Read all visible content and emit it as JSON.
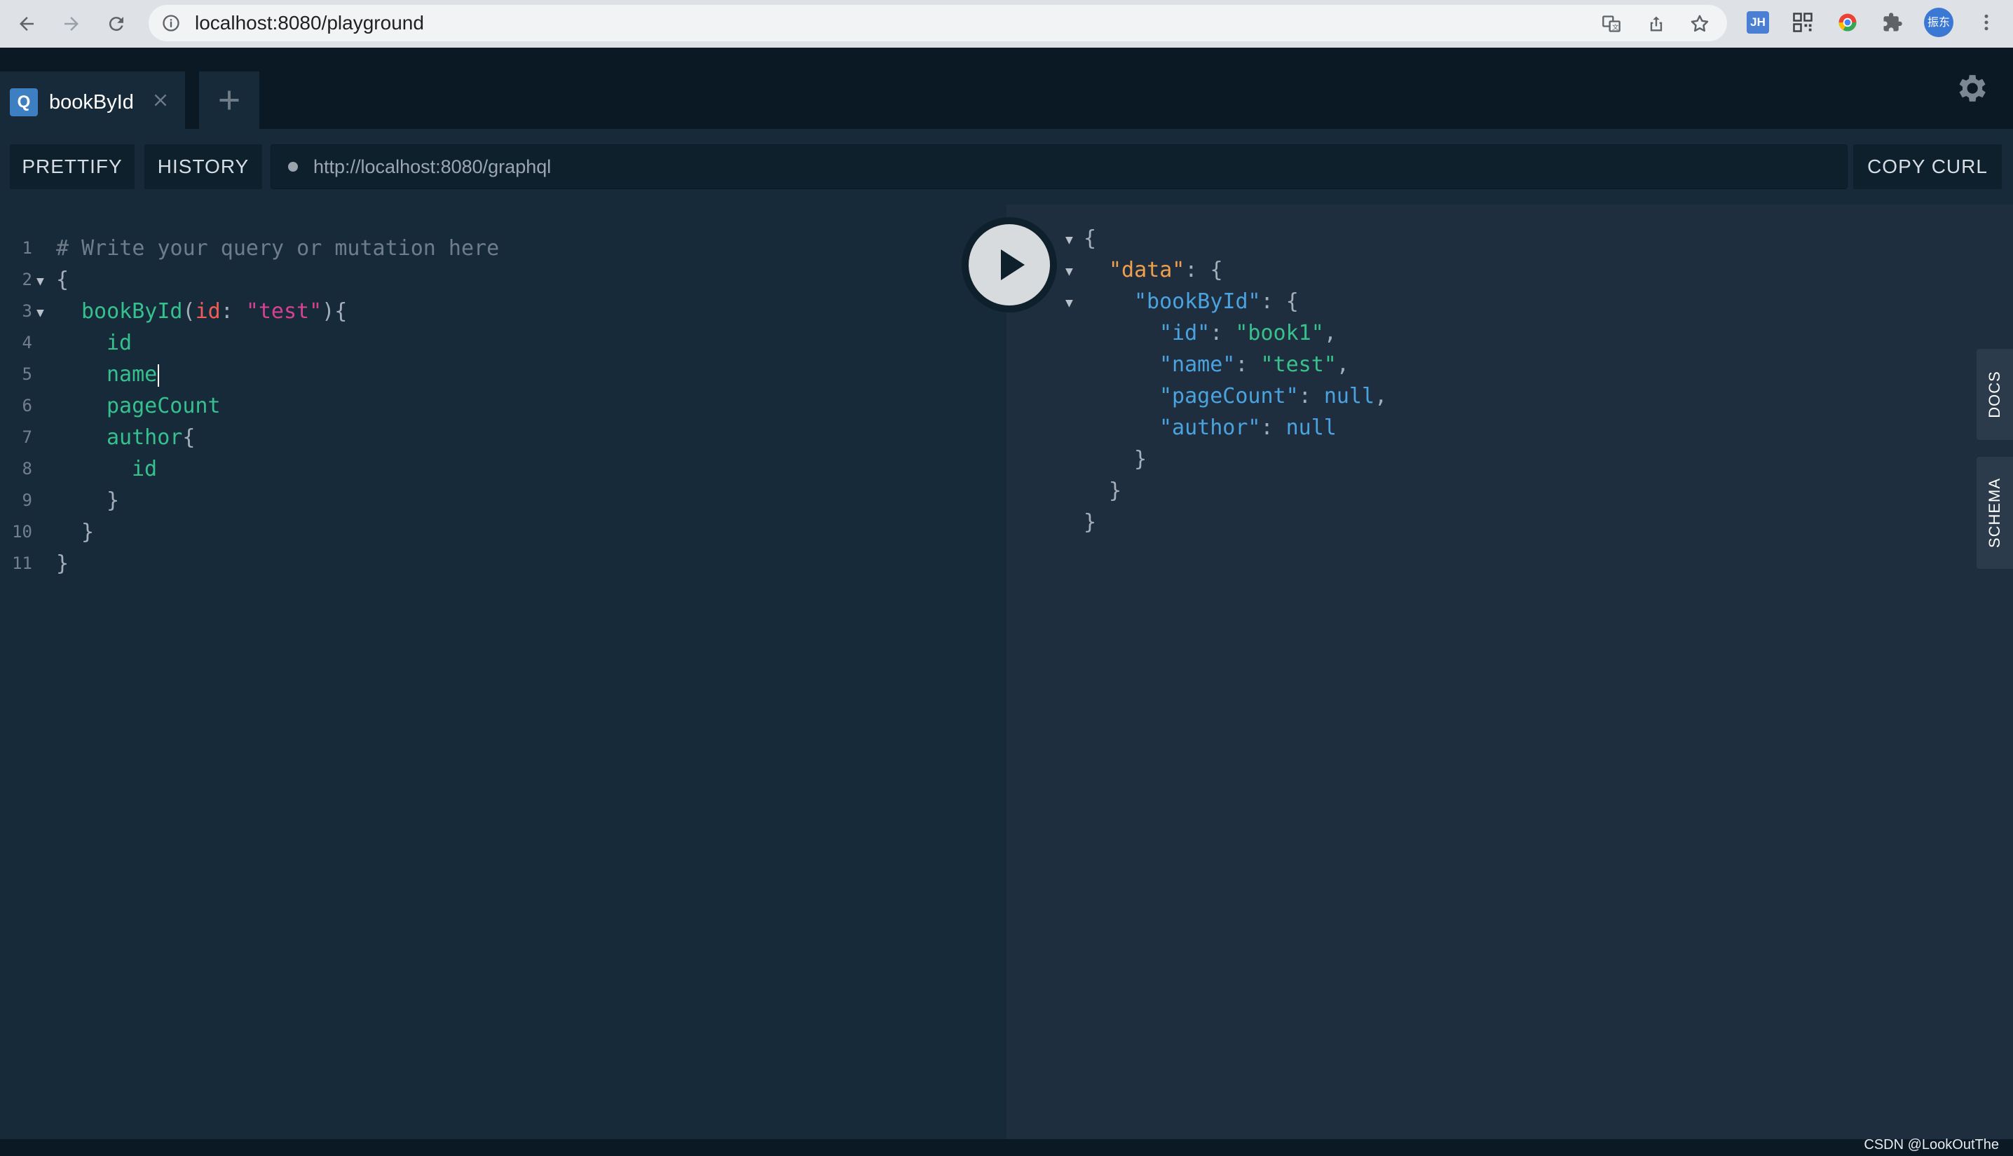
{
  "browser": {
    "url": "localhost:8080/playground",
    "profile_initials": "振东",
    "ext_label": "JH"
  },
  "tabs": [
    {
      "badge": "Q",
      "title": "bookById"
    }
  ],
  "toolbar": {
    "prettify": "PRETTIFY",
    "history": "HISTORY",
    "endpoint": "http://localhost:8080/graphql",
    "copy_curl": "COPY CURL"
  },
  "editor": {
    "line_numbers": [
      "1",
      "2",
      "3",
      "4",
      "5",
      "6",
      "7",
      "8",
      "9",
      "10",
      "11"
    ],
    "lines": {
      "comment": "# Write your query or mutation here",
      "open_brace": "{",
      "query_name": "bookById",
      "paren_open": "(",
      "arg_name": "id",
      "colon": ": ",
      "arg_value": "\"test\"",
      "paren_close": "){",
      "field_id": "id",
      "field_name": "name",
      "field_pagecount": "pageCount",
      "field_author": "author",
      "author_brace": "{",
      "field_author_id": "id",
      "close_brace": "}"
    }
  },
  "result": {
    "open": "{",
    "data_key": "\"data\"",
    "bookbyid_key": "\"bookById\"",
    "id_key": "\"id\"",
    "id_value": "\"book1\"",
    "name_key": "\"name\"",
    "name_value": "\"test\"",
    "pagecount_key": "\"pageCount\"",
    "pagecount_value": "null",
    "author_key": "\"author\"",
    "author_value": "null",
    "sep": ": ",
    "comma": ",",
    "brace_open": "{",
    "brace_close": "}"
  },
  "side_tabs": {
    "docs": "DOCS",
    "schema": "SCHEMA"
  },
  "watermark": "CSDN @LookOutThe"
}
